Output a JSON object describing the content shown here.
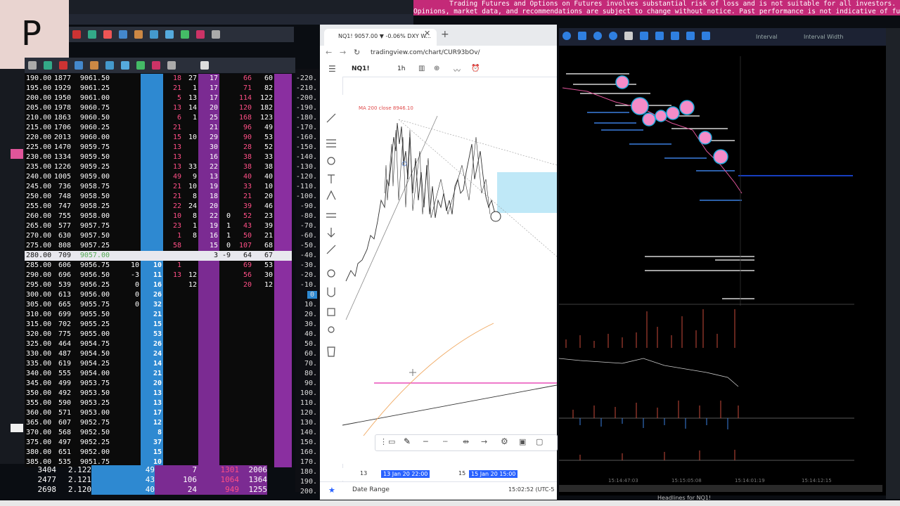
{
  "app": {
    "logo_letter": "P",
    "disclaimer_line1": "Trading Futures and Options on Futures involves substantial risk of loss and is not suitable for all investors.",
    "disclaimer_line2": "Opinions, market data, and recommendations are subject to change without notice. Past performance is not indicative of future results."
  },
  "colors": {
    "accent_bid": "#2e89d1",
    "accent_ask": "#7b2b92",
    "banner": "#c42a78"
  },
  "dom": {
    "rows": [
      [
        "190.00",
        "1877",
        "9061.50",
        "",
        "",
        "18",
        "27",
        "17",
        "",
        "66",
        "60"
      ],
      [
        "195.00",
        "1929",
        "9061.25",
        "",
        "",
        "21",
        "1",
        "17",
        "",
        "71",
        "82"
      ],
      [
        "200.00",
        "1950",
        "9061.00",
        "",
        "",
        "5",
        "13",
        "17",
        "",
        "114",
        "122"
      ],
      [
        "205.00",
        "1978",
        "9060.75",
        "",
        "",
        "13",
        "14",
        "20",
        "",
        "120",
        "182"
      ],
      [
        "210.00",
        "1863",
        "9060.50",
        "",
        "",
        "6",
        "1",
        "25",
        "",
        "168",
        "123"
      ],
      [
        "215.00",
        "1706",
        "9060.25",
        "",
        "",
        "21",
        "",
        "21",
        "",
        "96",
        "49"
      ],
      [
        "220.00",
        "2013",
        "9060.00",
        "",
        "",
        "15",
        "10",
        "29",
        "",
        "90",
        "53"
      ],
      [
        "225.00",
        "1470",
        "9059.75",
        "",
        "",
        "13",
        "",
        "30",
        "",
        "28",
        "52"
      ],
      [
        "230.00",
        "1334",
        "9059.50",
        "",
        "",
        "13",
        "",
        "16",
        "",
        "38",
        "33"
      ],
      [
        "235.00",
        "1226",
        "9059.25",
        "",
        "",
        "13",
        "33",
        "22",
        "",
        "38",
        "38"
      ],
      [
        "240.00",
        "1005",
        "9059.00",
        "",
        "",
        "49",
        "9",
        "13",
        "",
        "40",
        "40"
      ],
      [
        "245.00",
        "736",
        "9058.75",
        "",
        "",
        "21",
        "10",
        "19",
        "",
        "33",
        "10"
      ],
      [
        "250.00",
        "748",
        "9058.50",
        "",
        "",
        "21",
        "8",
        "18",
        "",
        "21",
        "20"
      ],
      [
        "255.00",
        "747",
        "9058.25",
        "",
        "",
        "22",
        "24",
        "20",
        "",
        "39",
        "46"
      ],
      [
        "260.00",
        "755",
        "9058.00",
        "",
        "",
        "10",
        "8",
        "22",
        "0",
        "52",
        "23"
      ],
      [
        "265.00",
        "577",
        "9057.75",
        "",
        "",
        "23",
        "1",
        "19",
        "1",
        "43",
        "39"
      ],
      [
        "270.00",
        "630",
        "9057.50",
        "",
        "",
        "1",
        "8",
        "16",
        "1",
        "50",
        "21"
      ],
      [
        "275.00",
        "808",
        "9057.25",
        "",
        "",
        "58",
        "",
        "15",
        "0",
        "107",
        "68"
      ],
      [
        "280.00",
        "709",
        "9057.00",
        "",
        "",
        "",
        "",
        "3",
        "-9",
        "64",
        "67"
      ],
      [
        "285.00",
        "606",
        "9056.75",
        "10",
        "10",
        "1",
        "",
        "",
        "",
        "69",
        "53"
      ],
      [
        "290.00",
        "696",
        "9056.50",
        "-3",
        "11",
        "13",
        "12",
        "",
        "",
        "56",
        "30"
      ],
      [
        "295.00",
        "539",
        "9056.25",
        "0",
        "16",
        "",
        "12",
        "",
        "",
        "20",
        "12"
      ],
      [
        "300.00",
        "613",
        "9056.00",
        "0",
        "26",
        "",
        "",
        "",
        "",
        "",
        ""
      ],
      [
        "305.00",
        "665",
        "9055.75",
        "0",
        "32",
        "",
        "",
        "",
        "",
        "",
        ""
      ],
      [
        "310.00",
        "699",
        "9055.50",
        "",
        "21",
        "",
        "",
        "",
        "",
        "",
        ""
      ],
      [
        "315.00",
        "702",
        "9055.25",
        "",
        "15",
        "",
        "",
        "",
        "",
        "",
        ""
      ],
      [
        "320.00",
        "775",
        "9055.00",
        "",
        "53",
        "",
        "",
        "",
        "",
        "",
        ""
      ],
      [
        "325.00",
        "464",
        "9054.75",
        "",
        "26",
        "",
        "",
        "",
        "",
        "",
        ""
      ],
      [
        "330.00",
        "487",
        "9054.50",
        "",
        "24",
        "",
        "",
        "",
        "",
        "",
        ""
      ],
      [
        "335.00",
        "619",
        "9054.25",
        "",
        "14",
        "",
        "",
        "",
        "",
        "",
        ""
      ],
      [
        "340.00",
        "555",
        "9054.00",
        "",
        "21",
        "",
        "",
        "",
        "",
        "",
        ""
      ],
      [
        "345.00",
        "499",
        "9053.75",
        "",
        "20",
        "",
        "",
        "",
        "",
        "",
        ""
      ],
      [
        "350.00",
        "492",
        "9053.50",
        "",
        "13",
        "",
        "",
        "",
        "",
        "",
        ""
      ],
      [
        "355.00",
        "590",
        "9053.25",
        "",
        "13",
        "",
        "",
        "",
        "",
        "",
        ""
      ],
      [
        "360.00",
        "571",
        "9053.00",
        "",
        "17",
        "",
        "",
        "",
        "",
        "",
        ""
      ],
      [
        "365.00",
        "607",
        "9052.75",
        "",
        "12",
        "",
        "",
        "",
        "",
        "",
        ""
      ],
      [
        "370.00",
        "568",
        "9052.50",
        "",
        "8",
        "",
        "",
        "",
        "",
        "",
        ""
      ],
      [
        "375.00",
        "497",
        "9052.25",
        "",
        "37",
        "",
        "",
        "",
        "",
        "",
        ""
      ],
      [
        "380.00",
        "651",
        "9052.00",
        "",
        "15",
        "",
        "",
        "",
        "",
        "",
        ""
      ],
      [
        "385.00",
        "535",
        "9051.75",
        "",
        "10",
        "",
        "",
        "",
        "",
        "",
        ""
      ]
    ],
    "current_row_index": 18,
    "mini_rows": [
      {
        "a": "3404",
        "b": "2.122",
        "c": "49",
        "d": "7",
        "e": "1301",
        "f": "2006"
      },
      {
        "a": "2477",
        "b": "2.121",
        "c": "43",
        "d": "106",
        "e": "1064",
        "f": "1364"
      },
      {
        "a": "2698",
        "b": "2.120",
        "c": "40",
        "d": "24",
        "e": "949",
        "f": "1255"
      }
    ]
  },
  "price_scale": {
    "labels": [
      "-220.",
      "-210.",
      "-200.",
      "-190.",
      "-180.",
      "-170.",
      "-160.",
      "-150.",
      "-140.",
      "-130.",
      "-120.",
      "-110.",
      "-100.",
      "-90.",
      "-80.",
      "-70.",
      "-60.",
      "-50.",
      "-40.",
      "-30.",
      "-20.",
      "-10.",
      "0",
      "10.",
      "20.",
      "30.",
      "40.",
      "50.",
      "60.",
      "70.",
      "80.",
      "90.",
      "100.",
      "110.",
      "120.",
      "130.",
      "140.",
      "150.",
      "160.",
      "170.",
      "180.",
      "190.",
      "200."
    ],
    "highlight": "0"
  },
  "browser": {
    "tab_title": "NQ1! 9057.00 ▼ -0.06% DXY W...",
    "url": "tradingview.com/chart/CUR93bOv/",
    "symbol": "NQ1!",
    "interval": "1h",
    "ma_label": "MA 200 close  8946.10",
    "x_labels": [
      "13",
      "13 Jan 20  22:00",
      "15",
      "15 Jan 20  15:00"
    ],
    "date_range": "Date Range",
    "time_readout": "15:02:52 (UTC-5"
  },
  "right_app": {
    "interval_label": "Interval",
    "interval_width_label": "Interval Width",
    "headlines": "Headlines for NQ1!",
    "time_labels": [
      "15:14:47:03",
      "15:15:05:08",
      "15:14:01:19",
      "15:14:12:15"
    ]
  }
}
